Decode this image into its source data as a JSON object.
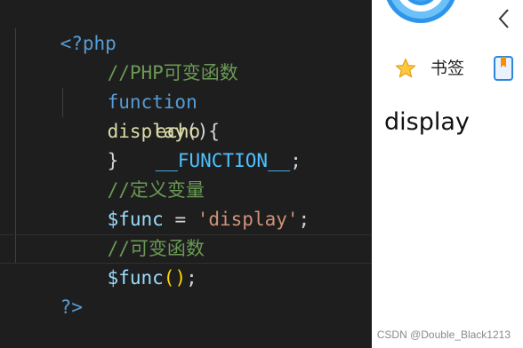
{
  "editor": {
    "open_tag": "<?php",
    "comment_1": "//PHP可变函数",
    "kw_function": "function",
    "fn_name": "display",
    "fn_parens": "()",
    "brace_open": "{",
    "echo": "echo",
    "magic_const": "__FUNCTION__",
    "semicolon": ";",
    "brace_close": "}",
    "comment_2": "//定义变量",
    "var_name": "$func",
    "assign": " = ",
    "string_value": "'display'",
    "semicolon_2": ";",
    "comment_3": "//可变函数",
    "call_var": "$func",
    "call_parens": "()",
    "semicolon_3": ";",
    "close_tag": "?>"
  },
  "browser": {
    "icons": {
      "logo": "browser-logo-icon",
      "back": "chevron-left-icon",
      "favorites": "star-icon",
      "bookmark": "bookmark-icon"
    },
    "bookmark_label": "书签",
    "output_text": "display",
    "watermark": "CSDN @Double_Black1213"
  },
  "colors": {
    "editor_background": "#1e1e1e",
    "keyword": "#569cd6",
    "comment": "#6a9955",
    "function": "#dcdcaa",
    "variable": "#9cdcfe",
    "string": "#ce9178",
    "constant": "#4fc1ff",
    "brace": "#ffd700"
  }
}
